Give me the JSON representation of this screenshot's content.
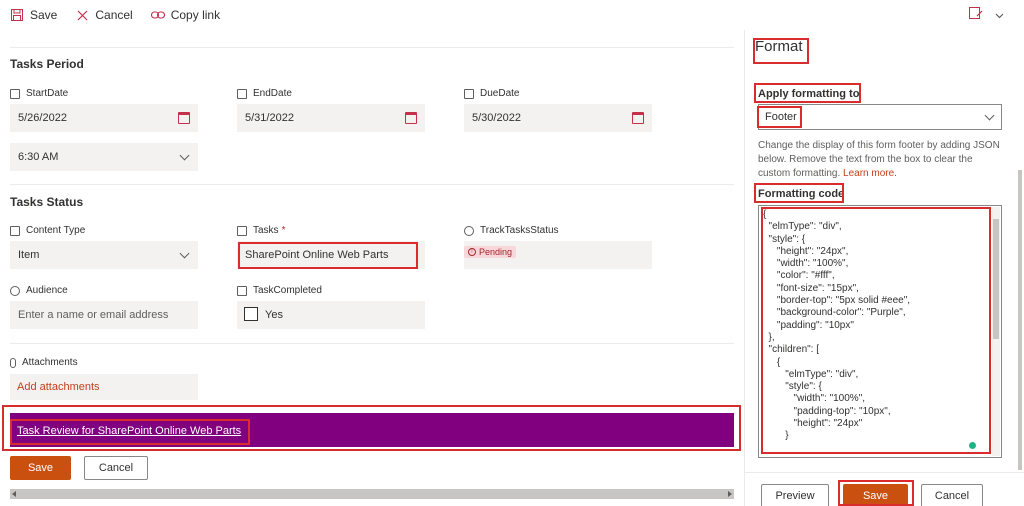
{
  "toolbar": {
    "save_label": "Save",
    "cancel_label": "Cancel",
    "copy_link_label": "Copy link"
  },
  "form": {
    "tasks_period_title": "Tasks Period",
    "start_date_label": "StartDate",
    "start_date_value": "5/26/2022",
    "end_date_label": "EndDate",
    "end_date_value": "5/31/2022",
    "due_date_label": "DueDate",
    "due_date_value": "5/30/2022",
    "time_value": "6:30 AM",
    "tasks_status_title": "Tasks Status",
    "content_type_label": "Content Type",
    "content_type_value": "Item",
    "tasks_label": "Tasks",
    "tasks_required_mark": "*",
    "tasks_value": "SharePoint Online Web Parts",
    "track_status_label": "TrackTasksStatus",
    "track_status_value": "Pending",
    "audience_label": "Audience",
    "audience_placeholder": "Enter a name or email address",
    "task_completed_label": "TaskCompleted",
    "task_completed_value": "Yes",
    "attachments_label": "Attachments",
    "add_attachments_label": "Add attachments",
    "footer_link_text": "Task Review for SharePoint Online Web Parts",
    "footer_bg_color": "#800080",
    "save_button": "Save",
    "cancel_button": "Cancel"
  },
  "panel": {
    "title": "Format",
    "apply_formatting_label": "Apply formatting to",
    "apply_formatting_value": "Footer",
    "description": "Change the display of this form footer by adding JSON below. Remove the text from the box to clear the custom formatting.",
    "learn_more": "Learn more.",
    "formatting_code_label": "Formatting code",
    "code_text": "{\n  \"elmType\": \"div\",\n  \"style\": {\n     \"height\": \"24px\",\n     \"width\": \"100%\",\n     \"color\": \"#fff\",\n     \"font-size\": \"15px\",\n     \"border-top\": \"5px solid #eee\",\n     \"background-color\": \"Purple\",\n     \"padding\": \"10px\"\n  },\n  \"children\": [\n     {\n        \"elmType\": \"div\",\n        \"style\": {\n           \"width\": \"100%\",\n           \"padding-top\": \"10px\",\n           \"height\": \"24px\"\n        }",
    "preview_button": "Preview",
    "save_button": "Save",
    "cancel_button": "Cancel"
  },
  "colors": {
    "accent": "#ca5010",
    "highlight_outline": "#d92d2d",
    "footer": "#800080"
  }
}
